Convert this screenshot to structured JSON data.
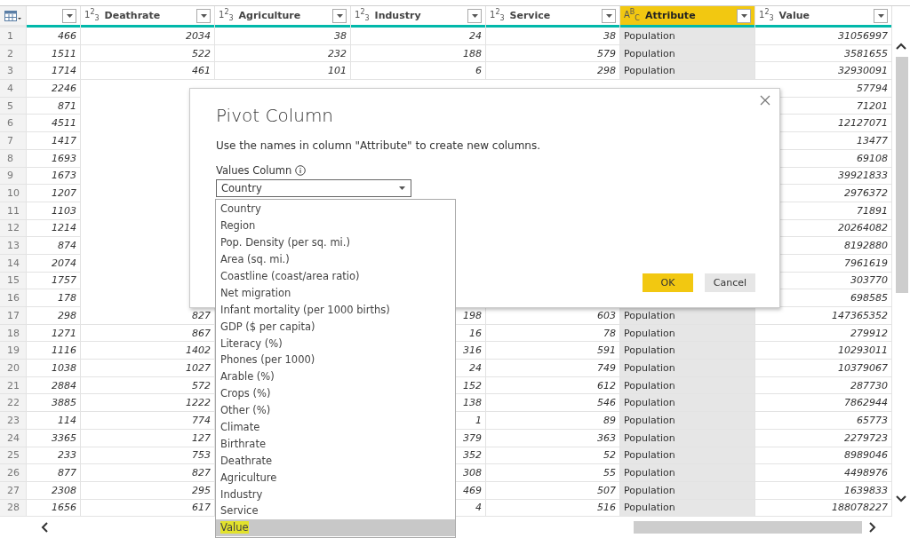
{
  "table": {
    "columns": [
      {
        "kind": "number",
        "selected": false
      },
      {
        "name": "Deathrate",
        "kind": "number",
        "type_label": "1$^{2}$$_{3}$",
        "selected": false
      },
      {
        "name": "Agriculture",
        "kind": "number",
        "type_label": "1$^{2}$$_{3}$",
        "selected": false
      },
      {
        "name": "Industry",
        "kind": "number",
        "type_label": "1$^{2}$$_{3}$",
        "selected": false
      },
      {
        "name": "Service",
        "kind": "number",
        "type_label": "1$^{2}$$_{3}$",
        "selected": false
      },
      {
        "name": "Attribute",
        "kind": "text",
        "type_label": "A$^{B}$$_{C}$",
        "selected": true
      },
      {
        "name": "Value",
        "kind": "number",
        "type_label": "1$^{2}$$_{3}$",
        "selected": false
      }
    ],
    "rows": [
      {
        "number": "1",
        "cells": [
          "466",
          "2034",
          "38",
          "24",
          "38",
          "Population",
          "31056997"
        ]
      },
      {
        "number": "2",
        "cells": [
          "1511",
          "522",
          "232",
          "188",
          "579",
          "Population",
          "3581655"
        ]
      },
      {
        "number": "3",
        "cells": [
          "1714",
          "461",
          "101",
          "6",
          "298",
          "Population",
          "32930091"
        ]
      },
      {
        "number": "4",
        "cells": [
          "2246",
          null,
          null,
          null,
          null,
          null,
          "57794"
        ]
      },
      {
        "number": "5",
        "cells": [
          "871",
          null,
          null,
          null,
          null,
          null,
          "71201"
        ]
      },
      {
        "number": "6",
        "cells": [
          "4511",
          null,
          null,
          null,
          null,
          null,
          "12127071"
        ]
      },
      {
        "number": "7",
        "cells": [
          "1417",
          null,
          null,
          null,
          null,
          null,
          "13477"
        ]
      },
      {
        "number": "8",
        "cells": [
          "1693",
          null,
          null,
          null,
          null,
          null,
          "69108"
        ]
      },
      {
        "number": "9",
        "cells": [
          "1673",
          null,
          null,
          null,
          null,
          null,
          "39921833"
        ]
      },
      {
        "number": "10",
        "cells": [
          "1207",
          null,
          null,
          null,
          null,
          null,
          "2976372"
        ]
      },
      {
        "number": "11",
        "cells": [
          "1103",
          null,
          null,
          null,
          null,
          null,
          "71891"
        ]
      },
      {
        "number": "12",
        "cells": [
          "1214",
          null,
          null,
          null,
          null,
          null,
          "20264082"
        ]
      },
      {
        "number": "13",
        "cells": [
          "874",
          null,
          null,
          null,
          null,
          null,
          "8192880"
        ]
      },
      {
        "number": "14",
        "cells": [
          "2074",
          null,
          null,
          null,
          null,
          null,
          "7961619"
        ]
      },
      {
        "number": "15",
        "cells": [
          "1757",
          null,
          null,
          null,
          null,
          null,
          "303770"
        ]
      },
      {
        "number": "16",
        "cells": [
          "178",
          null,
          null,
          null,
          null,
          null,
          "698585"
        ]
      },
      {
        "number": "17",
        "cells": [
          "298",
          "827",
          null,
          "198",
          "603",
          "Population",
          "147365352"
        ]
      },
      {
        "number": "18",
        "cells": [
          "1271",
          "867",
          null,
          "16",
          "78",
          "Population",
          "279912"
        ]
      },
      {
        "number": "19",
        "cells": [
          "1116",
          "1402",
          null,
          "316",
          "591",
          "Population",
          "10293011"
        ]
      },
      {
        "number": "20",
        "cells": [
          "1038",
          "1027",
          null,
          "24",
          "749",
          "Population",
          "10379067"
        ]
      },
      {
        "number": "21",
        "cells": [
          "2884",
          "572",
          null,
          "152",
          "612",
          "Population",
          "287730"
        ]
      },
      {
        "number": "22",
        "cells": [
          "3885",
          "1222",
          null,
          "138",
          "546",
          "Population",
          "7862944"
        ]
      },
      {
        "number": "23",
        "cells": [
          "114",
          "774",
          null,
          "1",
          "89",
          "Population",
          "65773"
        ]
      },
      {
        "number": "24",
        "cells": [
          "3365",
          "127",
          null,
          "379",
          "363",
          "Population",
          "2279723"
        ]
      },
      {
        "number": "25",
        "cells": [
          "233",
          "753",
          null,
          "352",
          "52",
          "Population",
          "8989046"
        ]
      },
      {
        "number": "26",
        "cells": [
          "877",
          "827",
          null,
          "308",
          "55",
          "Population",
          "4498976"
        ]
      },
      {
        "number": "27",
        "cells": [
          "2308",
          "295",
          null,
          "469",
          "507",
          "Population",
          "1639833"
        ]
      },
      {
        "number": "28",
        "cells": [
          "1656",
          "617",
          null,
          "4",
          "516",
          "Population",
          "188078227"
        ]
      }
    ]
  },
  "dialog": {
    "title": "Pivot Column",
    "description": "Use the names in column \"Attribute\" to create new columns.",
    "values_label": "Values Column",
    "values_select": {
      "value": "Country",
      "expanded": true
    },
    "options": [
      {
        "label": "Country",
        "selected": false
      },
      {
        "label": "Region",
        "selected": false
      },
      {
        "label": "Pop. Density (per sq. mi.)",
        "selected": false
      },
      {
        "label": "Area (sq. mi.)",
        "selected": false
      },
      {
        "label": "Coastline (coast/area ratio)",
        "selected": false
      },
      {
        "label": "Net migration",
        "selected": false
      },
      {
        "label": "Infant mortality (per 1000 births)",
        "selected": false
      },
      {
        "label": "GDP ($ per capita)",
        "selected": false
      },
      {
        "label": "Literacy (%)",
        "selected": false
      },
      {
        "label": "Phones (per 1000)",
        "selected": false
      },
      {
        "label": "Arable (%)",
        "selected": false
      },
      {
        "label": "Crops (%)",
        "selected": false
      },
      {
        "label": "Other (%)",
        "selected": false
      },
      {
        "label": "Climate",
        "selected": false
      },
      {
        "label": "Birthrate",
        "selected": false
      },
      {
        "label": "Deathrate",
        "selected": false
      },
      {
        "label": "Agriculture",
        "selected": false
      },
      {
        "label": "Industry",
        "selected": false
      },
      {
        "label": "Service",
        "selected": false
      },
      {
        "label": "Value",
        "selected": true
      }
    ],
    "buttons": [
      {
        "label": "OK",
        "kind": "primary"
      },
      {
        "label": "Cancel",
        "kind": "secondary"
      }
    ]
  }
}
